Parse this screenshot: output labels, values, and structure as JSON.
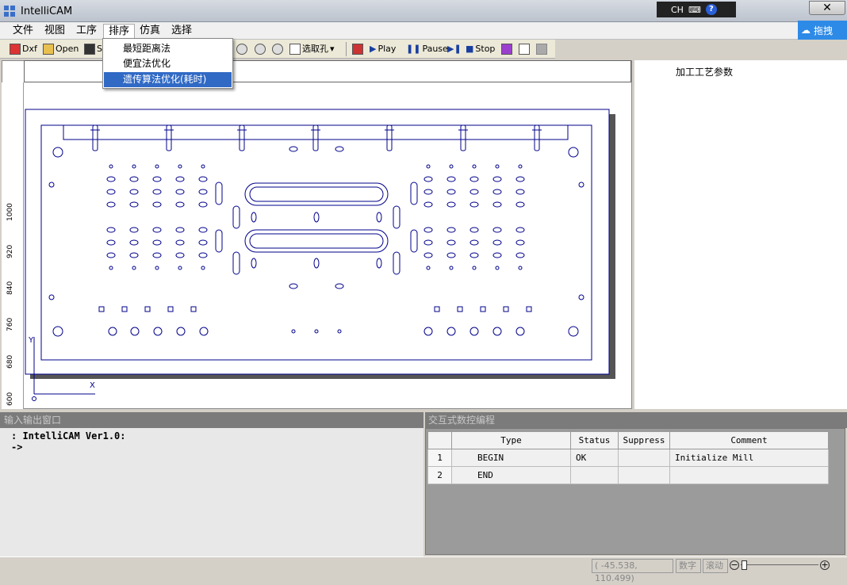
{
  "app": {
    "title": "IntelliCAM"
  },
  "ime": {
    "lang": "CH"
  },
  "cloud": {
    "label": "拖拽"
  },
  "menu": {
    "items": [
      "文件",
      "视图",
      "工序",
      "排序",
      "仿真",
      "选择"
    ]
  },
  "dropdown": {
    "items": [
      "最短距离法",
      "便宜法优化",
      "遗传算法优化(耗时)"
    ]
  },
  "toolbar": {
    "dxf": "Dxf",
    "open": "Open",
    "save": "S",
    "select_hole": "选取孔",
    "play": "Play",
    "pause": "Pause",
    "stop": "Stop"
  },
  "ruler": {
    "labels": [
      "1000",
      "920",
      "840",
      "760",
      "680",
      "600"
    ]
  },
  "axes": {
    "x": "X",
    "y": "Y"
  },
  "props": {
    "title": "加工工艺参数"
  },
  "io": {
    "header": "输入输出窗口",
    "lines": [
      ": IntelliCAM Ver1.0:",
      "->"
    ]
  },
  "nc": {
    "header": "交互式数控编程",
    "columns": [
      "Type",
      "Status",
      "Suppress",
      "Comment"
    ],
    "rows": [
      {
        "n": "1",
        "type": "BEGIN",
        "status": "OK",
        "suppress": "",
        "comment": "Initialize Mill"
      },
      {
        "n": "2",
        "type": "END",
        "status": "",
        "suppress": "",
        "comment": ""
      }
    ]
  },
  "status": {
    "coords": "( -45.538, 110.499)",
    "num": "数字",
    "scroll": "滚动"
  }
}
